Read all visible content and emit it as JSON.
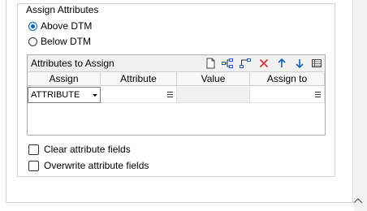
{
  "group": {
    "title": "Assign Attributes",
    "radio_options": [
      {
        "label": "Above DTM",
        "checked": true
      },
      {
        "label": "Below DTM",
        "checked": false
      }
    ]
  },
  "grid": {
    "title": "Attributes to Assign",
    "toolbar_icons": [
      "new-file-icon",
      "add-child-icon",
      "add-sibling-icon",
      "delete-icon",
      "move-up-icon",
      "move-down-icon",
      "table-view-icon"
    ],
    "columns": [
      "Assign",
      "Attribute",
      "Value",
      "Assign to"
    ],
    "rows": [
      {
        "assign": "ATTRIBUTE",
        "attribute": "",
        "value": "",
        "assign_to": ""
      }
    ]
  },
  "checkboxes": [
    {
      "label": "Clear attribute fields",
      "checked": false
    },
    {
      "label": "Overwrite attribute fields",
      "checked": false
    }
  ],
  "colors": {
    "accent": "#0067c0",
    "delete_red": "#d13438",
    "arrow_blue": "#1a5fb4"
  }
}
